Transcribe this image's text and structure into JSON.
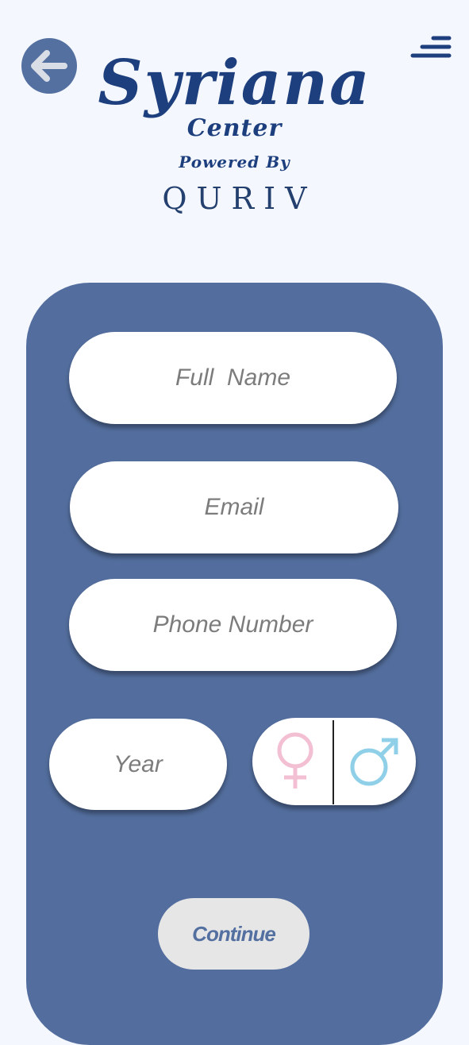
{
  "header": {
    "back_icon": "arrow-left-icon",
    "menu_icon": "hamburger-menu-icon"
  },
  "brand": {
    "title": "Syriana",
    "subtitle": "Center",
    "powered_by": "Powered By",
    "partner": "QURIV"
  },
  "form": {
    "full_name_placeholder": "Full  Name",
    "email_placeholder": "Email",
    "phone_placeholder": "Phone Number",
    "year_placeholder": "Year",
    "gender_options": [
      {
        "icon": "female-symbol-icon",
        "color": "#f3bfd3"
      },
      {
        "icon": "male-symbol-icon",
        "color": "#8fd0e8"
      }
    ],
    "continue_label": "Continue"
  },
  "colors": {
    "background": "#f4f7fd",
    "panel": "#536e9e",
    "brand_text": "#1e3f7d",
    "button_bg": "#e6e6e6"
  }
}
